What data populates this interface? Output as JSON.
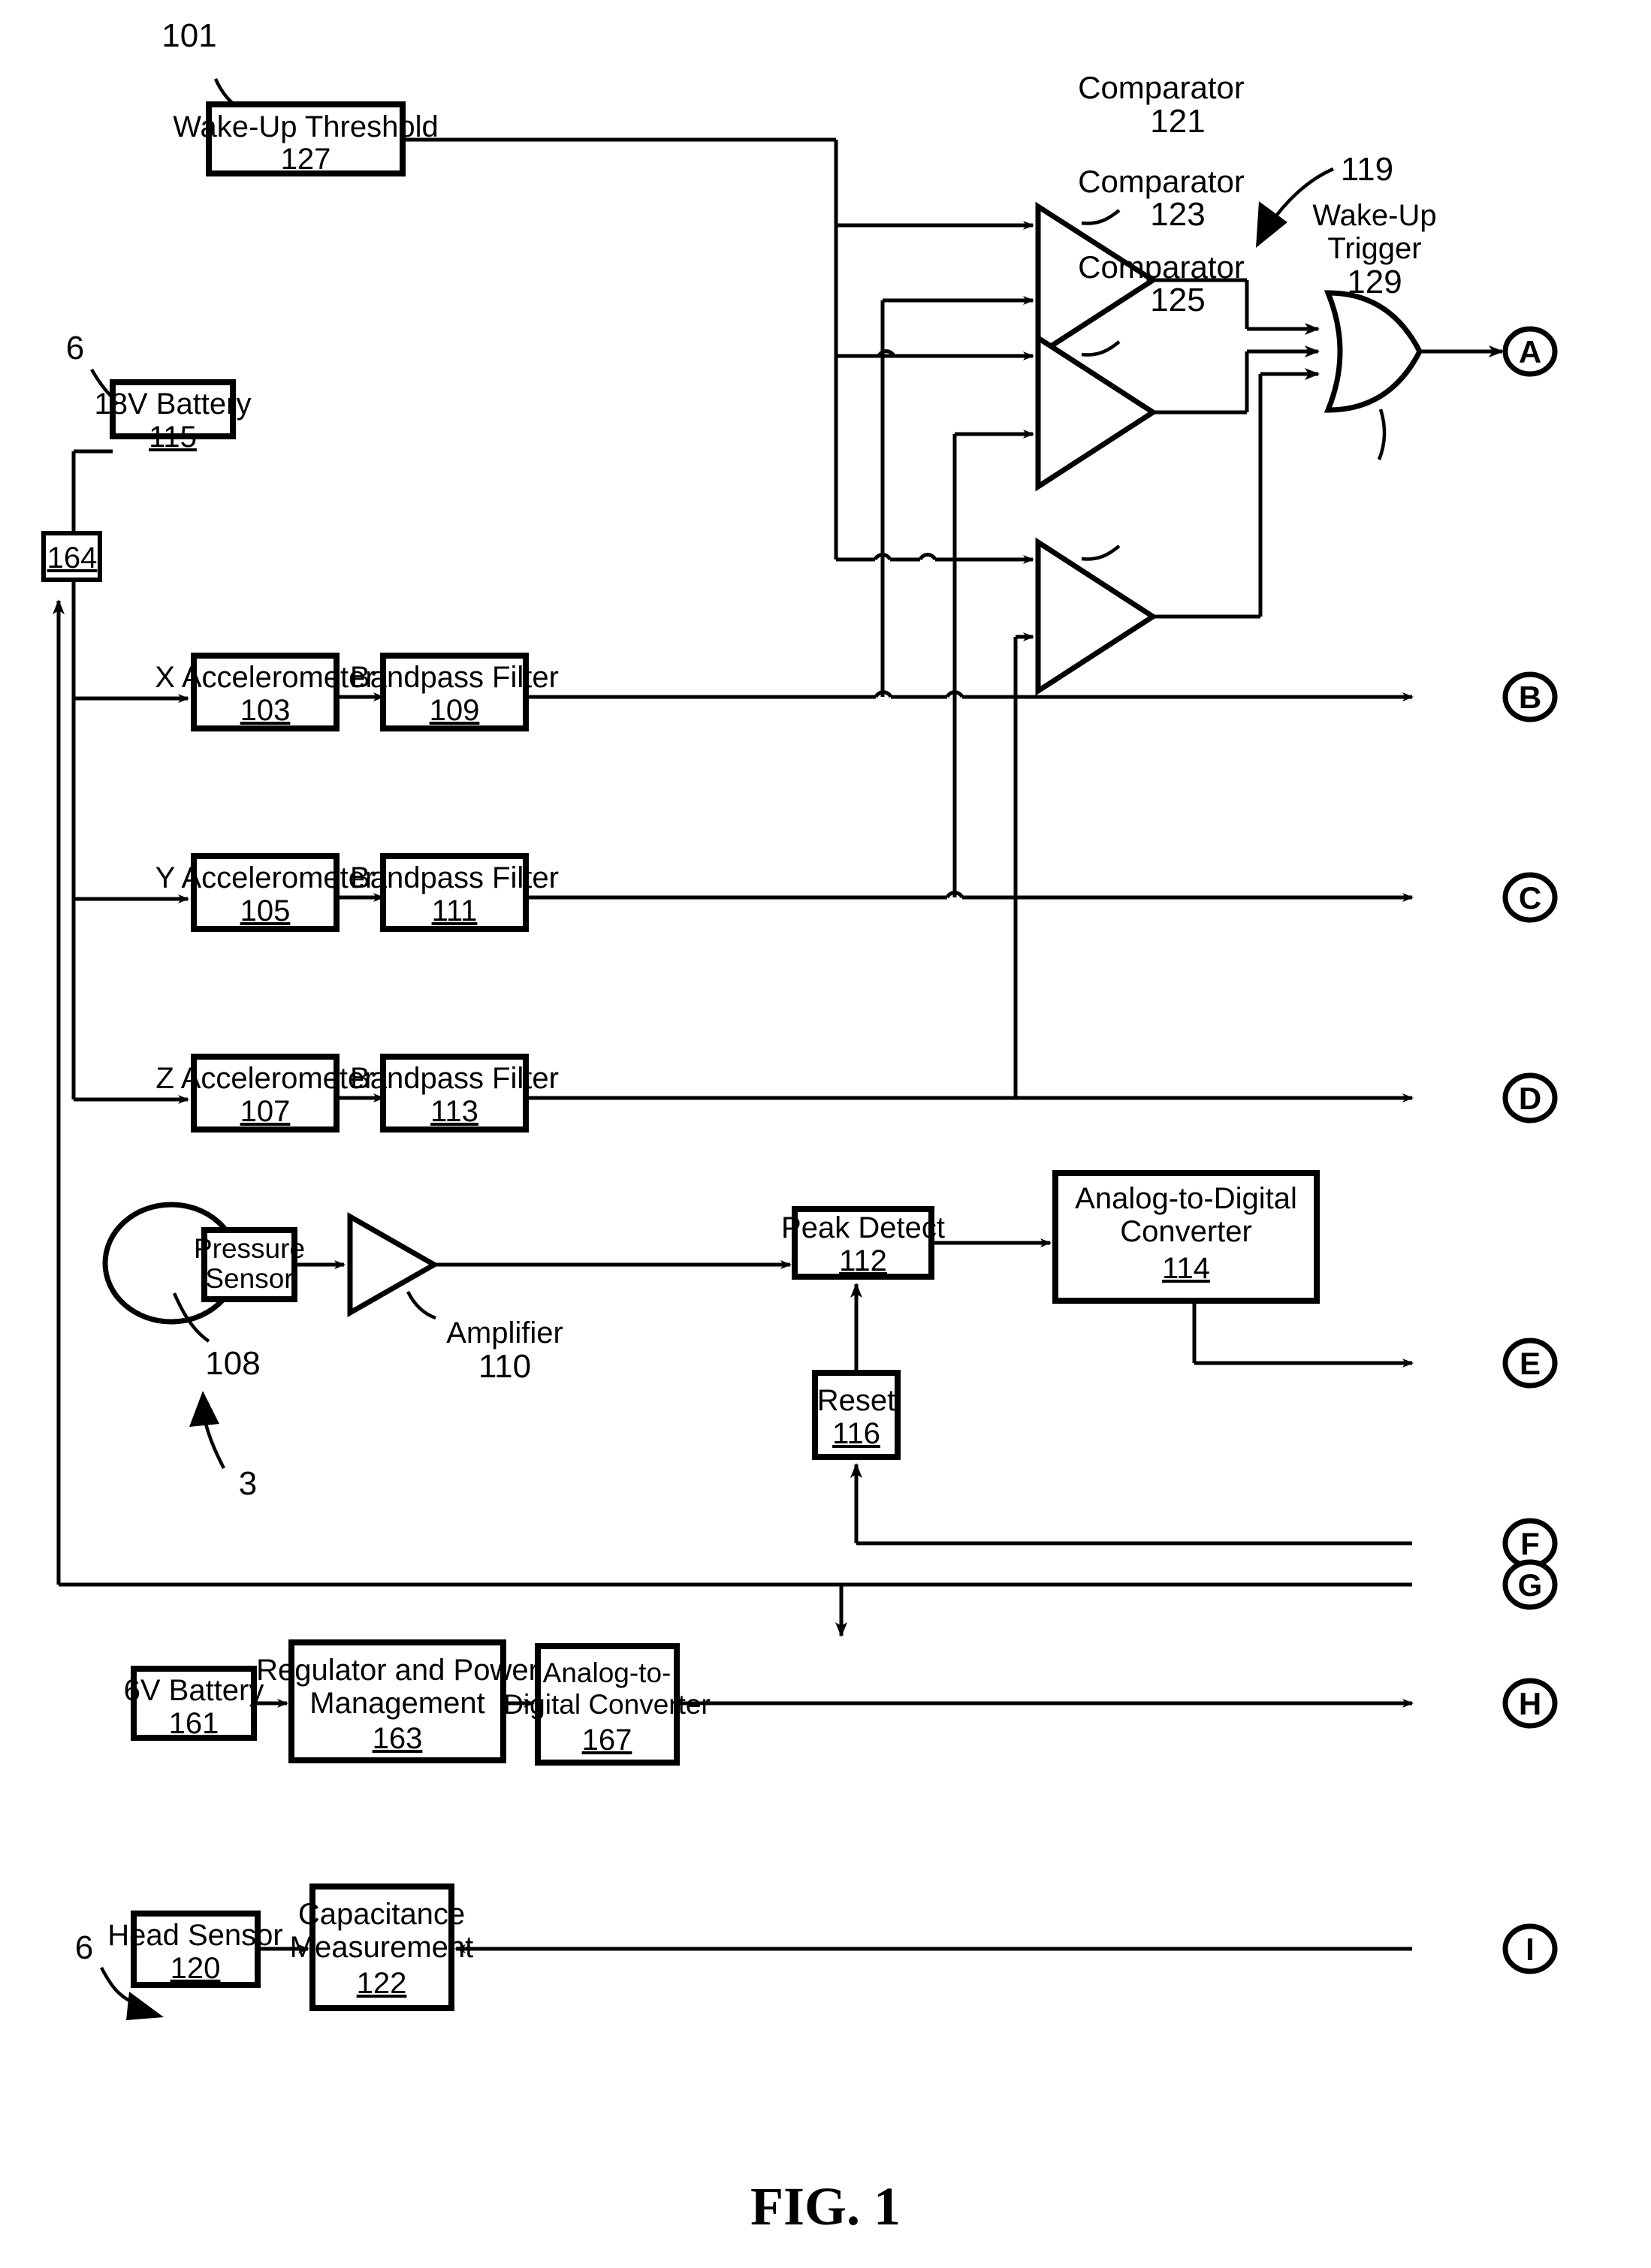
{
  "figure": {
    "caption": "FIG. 1",
    "system_ref": "101",
    "wakeup_circuit_ref": "119",
    "helmet_ref_top": "6",
    "helmet_ref_bottom": "6",
    "pressure_group_ref": "3"
  },
  "blocks": {
    "wake_up_threshold": {
      "label": "Wake-Up Threshold",
      "ref": "127"
    },
    "battery_18v": {
      "label": "18V Battery",
      "ref": "115"
    },
    "node_164": {
      "ref": "164"
    },
    "x_accelerometer": {
      "label": "X Accelerometer",
      "ref": "103"
    },
    "y_accelerometer": {
      "label": "Y Accelerometer",
      "ref": "105"
    },
    "z_accelerometer": {
      "label": "Z Accelerometer",
      "ref": "107"
    },
    "bandpass_x": {
      "label": "Bandpass Filter",
      "ref": "109"
    },
    "bandpass_y": {
      "label": "Bandpass Filter",
      "ref": "111"
    },
    "bandpass_z": {
      "label": "Bandpass Filter",
      "ref": "113"
    },
    "pressure_sensor": {
      "label_line1": "Pressure",
      "label_line2": "Sensor",
      "bladder_ref": "108"
    },
    "amplifier": {
      "label": "Amplifier",
      "ref": "110"
    },
    "peak_detect": {
      "label": "Peak Detect",
      "ref": "112"
    },
    "adc_114": {
      "label_line1": "Analog-to-Digital",
      "label_line2": "Converter",
      "ref": "114"
    },
    "reset": {
      "label": "Reset",
      "ref": "116"
    },
    "battery_6v": {
      "label": "6V Battery",
      "ref": "161"
    },
    "regulator": {
      "label_line1": "Regulator and Power",
      "label_line2": "Management",
      "ref": "163"
    },
    "adc_167": {
      "label_line1": "Analog-to-",
      "label_line2": "Digital Converter",
      "ref": "167"
    },
    "head_sensor": {
      "label": "Head Sensor",
      "ref": "120"
    },
    "capacitance_measurement": {
      "label_line1": "Capacitance",
      "label_line2": "Measurement",
      "ref": "122"
    }
  },
  "comparators": [
    {
      "title": "Comparator",
      "ref": "121"
    },
    {
      "title": "Comparator",
      "ref": "123"
    },
    {
      "title": "Comparator",
      "ref": "125"
    }
  ],
  "or_gate": {
    "label_line1": "Wake-Up",
    "label_line2": "Trigger",
    "ref": "129"
  },
  "terminals": [
    {
      "id": "A",
      "label": "A"
    },
    {
      "id": "B",
      "label": "B"
    },
    {
      "id": "C",
      "label": "C"
    },
    {
      "id": "D",
      "label": "D"
    },
    {
      "id": "E",
      "label": "E"
    },
    {
      "id": "F",
      "label": "F"
    },
    {
      "id": "G",
      "label": "G"
    },
    {
      "id": "H",
      "label": "H"
    },
    {
      "id": "I",
      "label": "I"
    }
  ],
  "colors": {
    "ink": "#000000",
    "paper": "#ffffff"
  }
}
